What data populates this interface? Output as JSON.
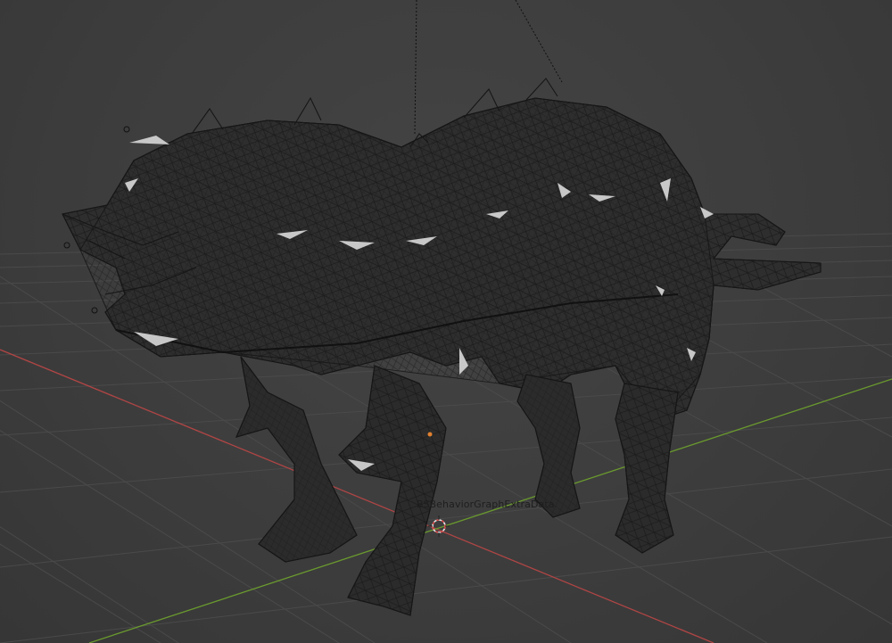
{
  "viewport": {
    "object_label": "BSBehaviorGraphExtraData",
    "colors": {
      "background": "#3d3d3d",
      "grid": "#4a4a4a",
      "x_axis": "#b04545",
      "y_axis": "#6a9a2e",
      "wire": "#1a1a1a",
      "faces": "#c8c8c8",
      "cursor_ring": "#e8e8e8",
      "cursor_dash": "#d04040"
    },
    "icons": [
      "3d-cursor-icon",
      "light-empty-icon"
    ]
  }
}
